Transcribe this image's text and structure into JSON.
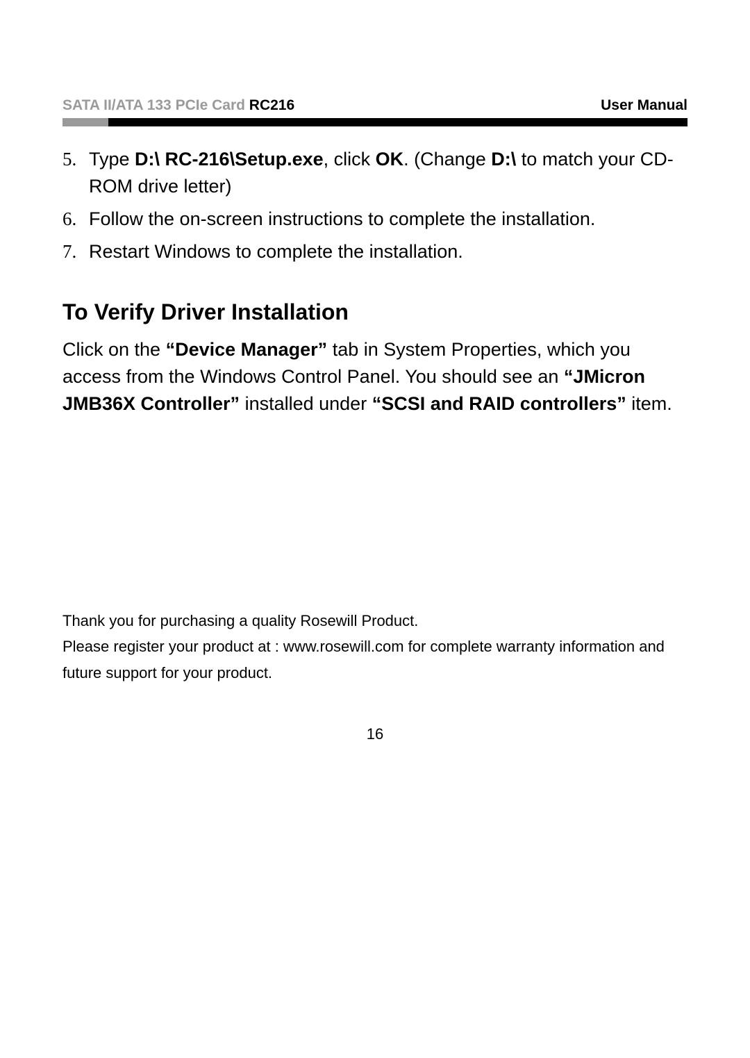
{
  "header": {
    "product_line": "SATA II/ATA 133 PCIe Card ",
    "model": "RC216",
    "doc_type": "User Manual"
  },
  "steps": [
    {
      "num": "5.",
      "segments": [
        {
          "text": "Type ",
          "bold": false
        },
        {
          "text": "D:\\ RC-216\\Setup.exe",
          "bold": true
        },
        {
          "text": ", click ",
          "bold": false
        },
        {
          "text": "OK",
          "bold": true
        },
        {
          "text": ". (Change ",
          "bold": false
        },
        {
          "text": "D:\\",
          "bold": true
        },
        {
          "text": " to match your CD-ROM drive letter)",
          "bold": false
        }
      ]
    },
    {
      "num": "6.",
      "segments": [
        {
          "text": "Follow the on-screen instructions to complete the installation.",
          "bold": false
        }
      ]
    },
    {
      "num": "7.",
      "segments": [
        {
          "text": "Restart Windows to complete the installation.",
          "bold": false
        }
      ]
    }
  ],
  "section_heading": "To Verify Driver Installation",
  "verify_para_segments": [
    {
      "text": "Click on the ",
      "bold": false
    },
    {
      "text": "“Device Manager”",
      "bold": true
    },
    {
      "text": " tab in System Properties, which you access from the Windows Control Panel. You should see an ",
      "bold": false
    },
    {
      "text": "“JMicron JMB36X Controller”",
      "bold": true
    },
    {
      "text": " installed under ",
      "bold": false
    },
    {
      "text": "“SCSI and RAID controllers”",
      "bold": true
    },
    {
      "text": " item.",
      "bold": false
    }
  ],
  "footer": {
    "line1": "Thank you for purchasing a quality Rosewill Product.",
    "line2": "Please register your product at : www.rosewill.com for complete warranty information and future support for your product."
  },
  "page_number": "16"
}
